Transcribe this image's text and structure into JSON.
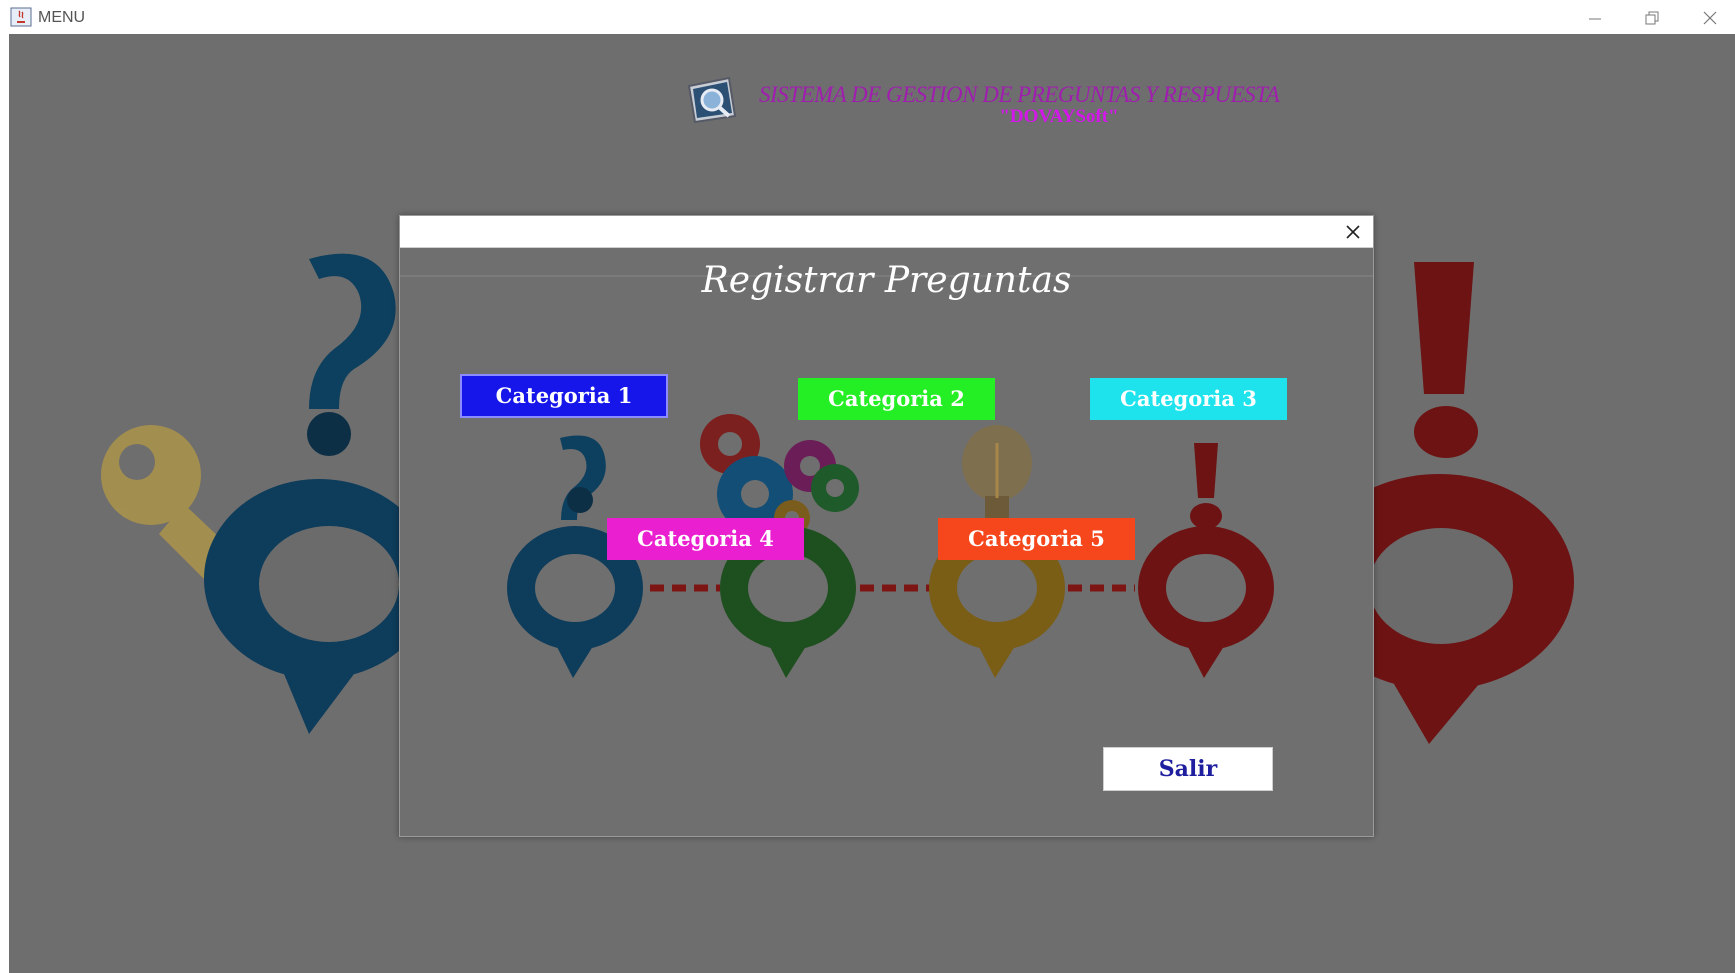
{
  "window": {
    "title": "MENU"
  },
  "header": {
    "title": "SISTEMA DE GESTION DE PREGUNTAS Y RESPUESTA",
    "subtitle": "\"DOVAYSoft\"",
    "logo_icon": "magnifier-monitor-icon"
  },
  "dialog": {
    "heading": "Registrar Preguntas",
    "close_icon": "close-icon",
    "buttons": {
      "categoria_1": "Categoria 1",
      "categoria_2": "Categoria 2",
      "categoria_3": "Categoria 3",
      "categoria_4": "Categoria 4",
      "categoria_5": "Categoria 5",
      "salir": "Salir"
    }
  },
  "colors": {
    "categoria_1": "#1616ea",
    "categoria_2": "#24ee24",
    "categoria_3": "#1ee3ec",
    "categoria_4": "#ea1fcf",
    "categoria_5": "#f5461c",
    "header_title": "#a11db0",
    "header_subtitle": "#d416ea"
  }
}
